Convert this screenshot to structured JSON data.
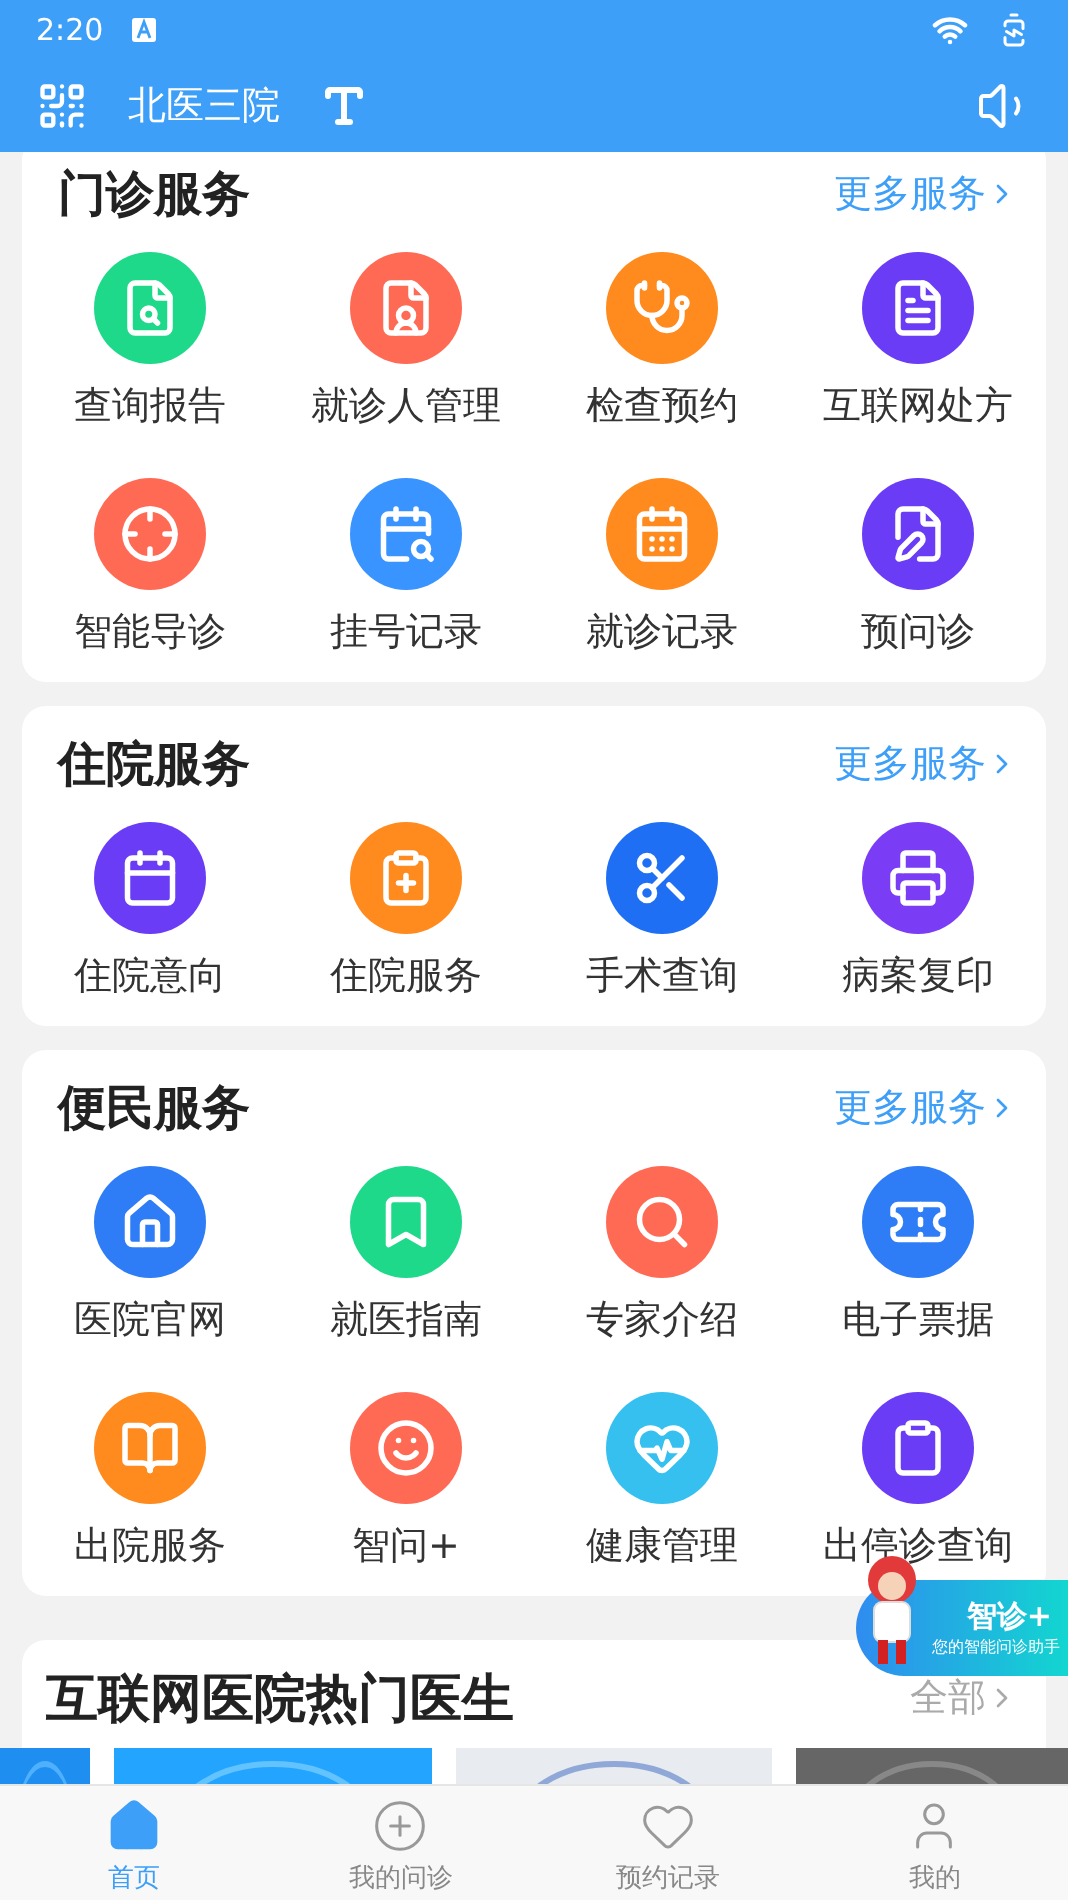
{
  "status_bar": {
    "time": "2:20"
  },
  "header": {
    "title": "北医三院"
  },
  "sections": [
    {
      "title": "门诊服务",
      "more": "更多服务",
      "items": [
        {
          "label": "查询报告",
          "color": "#1fd98a"
        },
        {
          "label": "就诊人管理",
          "color": "#ff6a55"
        },
        {
          "label": "检查预约",
          "color": "#ff8a1e"
        },
        {
          "label": "互联网处方",
          "color": "#6a3cf5"
        },
        {
          "label": "智能导诊",
          "color": "#ff6a55"
        },
        {
          "label": "挂号记录",
          "color": "#3a94ff"
        },
        {
          "label": "就诊记录",
          "color": "#ff8a1e"
        },
        {
          "label": "预问诊",
          "color": "#6a3cf5"
        }
      ]
    },
    {
      "title": "住院服务",
      "more": "更多服务",
      "items": [
        {
          "label": "住院意向",
          "color": "#6a3cf5"
        },
        {
          "label": "住院服务",
          "color": "#ff8a1e"
        },
        {
          "label": "手术查询",
          "color": "#1f6ff5"
        },
        {
          "label": "病案复印",
          "color": "#7a3cf5"
        }
      ]
    },
    {
      "title": "便民服务",
      "more": "更多服务",
      "items": [
        {
          "label": "医院官网",
          "color": "#2e7cf6"
        },
        {
          "label": "就医指南",
          "color": "#1fd98a"
        },
        {
          "label": "专家介绍",
          "color": "#ff6a55"
        },
        {
          "label": "电子票据",
          "color": "#2e7cf6"
        },
        {
          "label": "出院服务",
          "color": "#ff8a1e"
        },
        {
          "label": "智问+",
          "color": "#ff6a55"
        },
        {
          "label": "健康管理",
          "color": "#35c0f0"
        },
        {
          "label": "出停诊查询",
          "color": "#6a3cf5"
        }
      ]
    }
  ],
  "doctors": {
    "title": "互联网医院热门医生",
    "more": "全部"
  },
  "assistant": {
    "title": "智诊+",
    "subtitle": "您的智能问诊助手"
  },
  "tabs": [
    {
      "label": "首页",
      "selected": true
    },
    {
      "label": "我的问诊",
      "selected": false
    },
    {
      "label": "预约记录",
      "selected": false
    },
    {
      "label": "我的",
      "selected": false
    }
  ]
}
